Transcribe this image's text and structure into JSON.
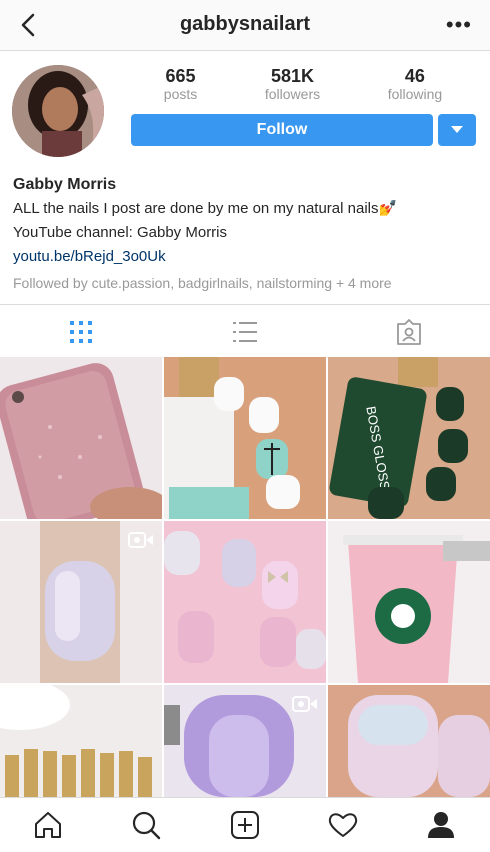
{
  "header": {
    "title": "gabbysnailart",
    "back_icon": "chevron-left-icon",
    "more_icon": "more-horizontal-icon",
    "more_label": "•••"
  },
  "profile": {
    "stats": [
      {
        "value": "665",
        "label": "posts"
      },
      {
        "value": "581K",
        "label": "followers"
      },
      {
        "value": "46",
        "label": "following"
      }
    ],
    "follow_label": "Follow",
    "accent_color": "#3897f0",
    "name": "Gabby Morris",
    "bio_line1": "ALL the nails I post are done by me on my natural nails💅",
    "bio_line2": "YouTube channel: Gabby Morris",
    "link": "youtu.be/bRejd_3o0Uk",
    "followed_by": "Followed by cute.passion, badgirlnails, nailstorming + 4 more"
  },
  "tabs": [
    {
      "icon": "grid-icon",
      "active": true
    },
    {
      "icon": "list-icon",
      "active": false
    },
    {
      "icon": "tagged-icon",
      "active": false
    }
  ],
  "grid": [
    {
      "desc": "pink-glitter-phone-case"
    },
    {
      "desc": "white-palm-tree-nails"
    },
    {
      "desc": "dark-green-nail-polish"
    },
    {
      "desc": "holographic-nail",
      "video": true
    },
    {
      "desc": "pink-holo-bow-nails"
    },
    {
      "desc": "pink-starbucks-drink"
    },
    {
      "desc": "gold-lipstick-tubes"
    },
    {
      "desc": "purple-glitter-nail",
      "video": true
    },
    {
      "desc": "pastel-ombre-nails"
    }
  ],
  "bottom_nav": [
    {
      "icon": "home-icon"
    },
    {
      "icon": "search-icon"
    },
    {
      "icon": "add-post-icon"
    },
    {
      "icon": "heart-icon"
    },
    {
      "icon": "profile-icon"
    }
  ]
}
